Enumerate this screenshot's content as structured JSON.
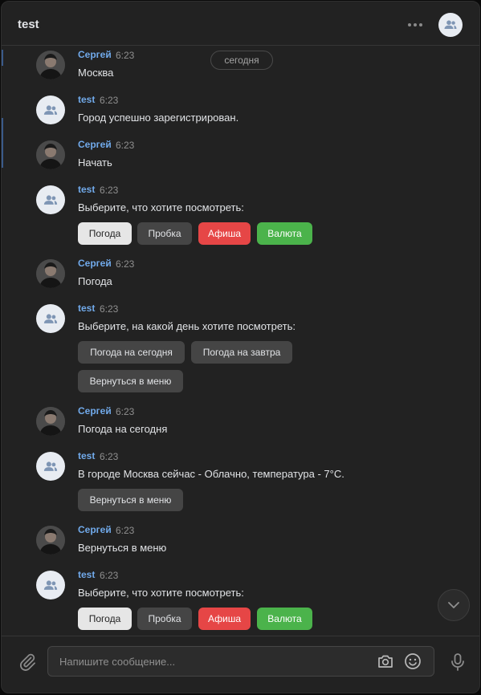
{
  "header": {
    "title": "test"
  },
  "date_separator": "сегодня",
  "messages": [
    {
      "author": "Сергей",
      "time": "6:23",
      "text": "Москва",
      "avatar": "photo"
    },
    {
      "author": "test",
      "time": "6:23",
      "text": "Город успешно зарегистрирован.",
      "avatar": "group-icon"
    },
    {
      "author": "Сергей",
      "time": "6:23",
      "text": "Начать",
      "avatar": "photo"
    },
    {
      "author": "test",
      "time": "6:23",
      "text": "Выберите, что хотите посмотреть:",
      "avatar": "group-icon",
      "buttons": [
        "Погода",
        "Пробка",
        "Афиша",
        "Валюта"
      ]
    },
    {
      "author": "Сергей",
      "time": "6:23",
      "text": "Погода",
      "avatar": "photo"
    },
    {
      "author": "test",
      "time": "6:23",
      "text": "Выберите, на какой день хотите посмотреть:",
      "avatar": "group-icon",
      "buttons": [
        "Погода на сегодня",
        "Погода на завтра",
        "Вернуться в меню"
      ]
    },
    {
      "author": "Сергей",
      "time": "6:23",
      "text": "Погода на сегодня",
      "avatar": "photo"
    },
    {
      "author": "test",
      "time": "6:23",
      "text": "В городе Москва сейчас - Облачно, температура - 7°С.",
      "avatar": "group-icon",
      "buttons": [
        "Вернуться в меню"
      ]
    },
    {
      "author": "Сергей",
      "time": "6:23",
      "text": "Вернуться в меню",
      "avatar": "photo"
    },
    {
      "author": "test",
      "time": "6:23",
      "text": "Выберите, что хотите посмотреть:",
      "avatar": "group-icon",
      "buttons": [
        "Погода",
        "Пробка",
        "Афиша",
        "Валюта"
      ]
    }
  ],
  "composer": {
    "placeholder": "Напишите сообщение..."
  },
  "colors": {
    "background": "#222222",
    "author": "#71aaeb",
    "button_red": "#e64646",
    "button_green": "#4bb34b",
    "button_white": "#e6e6e6",
    "button_grey": "#454545"
  }
}
